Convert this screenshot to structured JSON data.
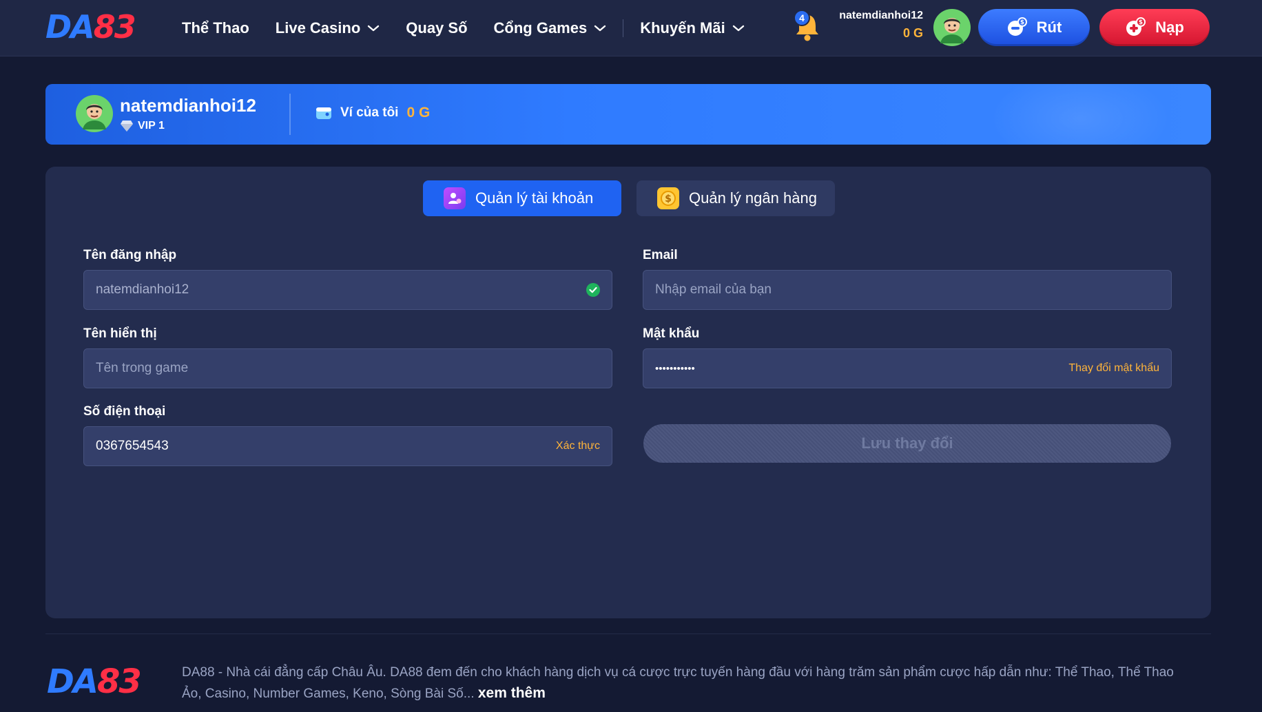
{
  "brand": {
    "logo_da": "DA",
    "logo_num": "83"
  },
  "nav": {
    "items": [
      {
        "label": "Thể Thao",
        "has_dropdown": false
      },
      {
        "label": "Live Casino",
        "has_dropdown": true
      },
      {
        "label": "Quay Số",
        "has_dropdown": false
      },
      {
        "label": "Cổng Games",
        "has_dropdown": true
      },
      {
        "label": "Khuyến Mãi",
        "has_dropdown": true
      }
    ]
  },
  "header": {
    "notification_count": "4",
    "username": "natemdianhoi12",
    "balance": "0 G",
    "withdraw_label": "Rút",
    "deposit_label": "Nạp",
    "icons": {
      "notification": "bell-icon",
      "withdraw": "coin-out-icon",
      "deposit": "coin-plus-icon"
    }
  },
  "profile": {
    "name": "natemdianhoi12",
    "vip": "VIP 1",
    "wallet_label": "Ví của tôi",
    "wallet_balance": "0 G"
  },
  "tabs": [
    {
      "label": "Quản lý tài khoản",
      "active": true,
      "icon": "user-gear-icon"
    },
    {
      "label": "Quản lý ngân hàng",
      "active": false,
      "icon": "dollar-coin-icon"
    }
  ],
  "form": {
    "username": {
      "label": "Tên đăng nhập",
      "value": "natemdianhoi12",
      "verified": true
    },
    "email": {
      "label": "Email",
      "value": "",
      "placeholder": "Nhập email của bạn"
    },
    "display_name": {
      "label": "Tên hiển thị",
      "value": "",
      "placeholder": "Tên trong game"
    },
    "password": {
      "label": "Mật khẩu",
      "value": "•••••••••••",
      "action": "Thay đổi mật khẩu"
    },
    "phone": {
      "label": "Số điện thoại",
      "value": "0367654543",
      "action": "Xác thực"
    },
    "save_label": "Lưu thay đổi"
  },
  "footer": {
    "text": "DA88 - Nhà cái đẳng cấp Châu Âu. DA88 đem đến cho khách hàng dịch vụ cá cược trực tuyến hàng đầu với hàng trăm sản phẩm cược hấp dẫn như: Thể Thao, Thể Thao Ảo, Casino, Number Games, Keno, Sòng Bài Số...",
    "more_label": "xem thêm"
  },
  "colors": {
    "accent_blue": "#1f63f2",
    "accent_red": "#d4152f",
    "balance_gold": "#ffb43a",
    "background": "#141a33"
  }
}
